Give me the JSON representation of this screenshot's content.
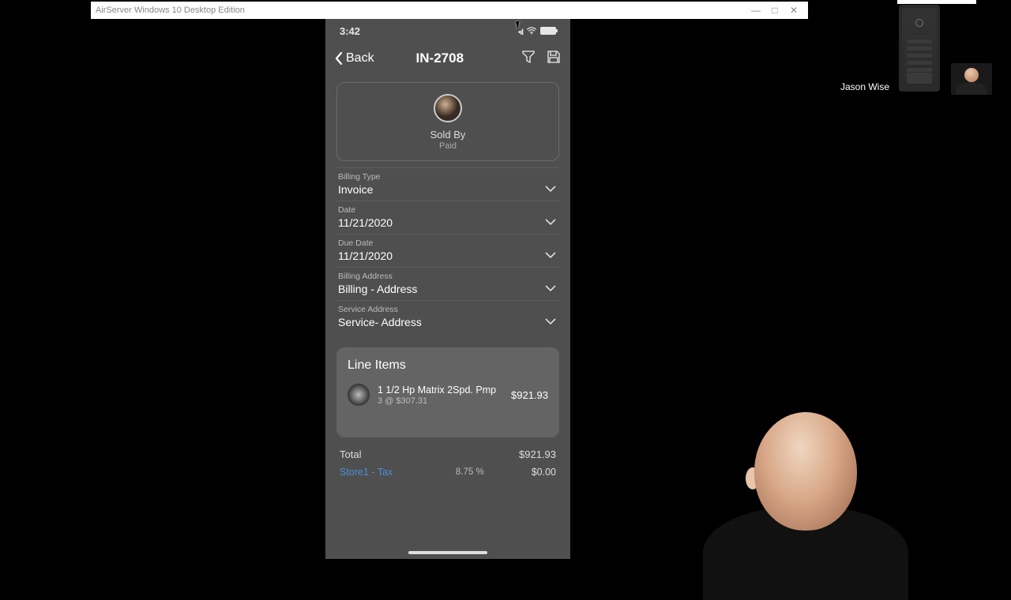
{
  "window": {
    "title": "AirServer Windows 10 Desktop Edition"
  },
  "status": {
    "time": "3:42"
  },
  "nav": {
    "back": "Back",
    "title": "IN-2708"
  },
  "sold": {
    "label": "Sold By",
    "status": "Paid"
  },
  "fields": {
    "billing_type": {
      "label": "Billing Type",
      "value": "Invoice"
    },
    "date": {
      "label": "Date",
      "value": "11/21/2020"
    },
    "due_date": {
      "label": "Due Date",
      "value": "11/21/2020"
    },
    "billing_addr": {
      "label": "Billing Address",
      "value": "Billing - Address"
    },
    "service_addr": {
      "label": "Service Address",
      "value": "Service- Address"
    }
  },
  "line_items": {
    "title": "Line Items",
    "item": {
      "name": "1 1/2 Hp Matrix 2Spd. Pmp",
      "qty": "3 @ $307.31",
      "price": "$921.93"
    }
  },
  "totals": {
    "total_label": "Total",
    "total_value": "$921.93",
    "tax_label": "Store1 - Tax",
    "tax_pct": "8.75 %",
    "tax_value": "$0.00"
  },
  "participant": {
    "name": "Jason Wise"
  }
}
